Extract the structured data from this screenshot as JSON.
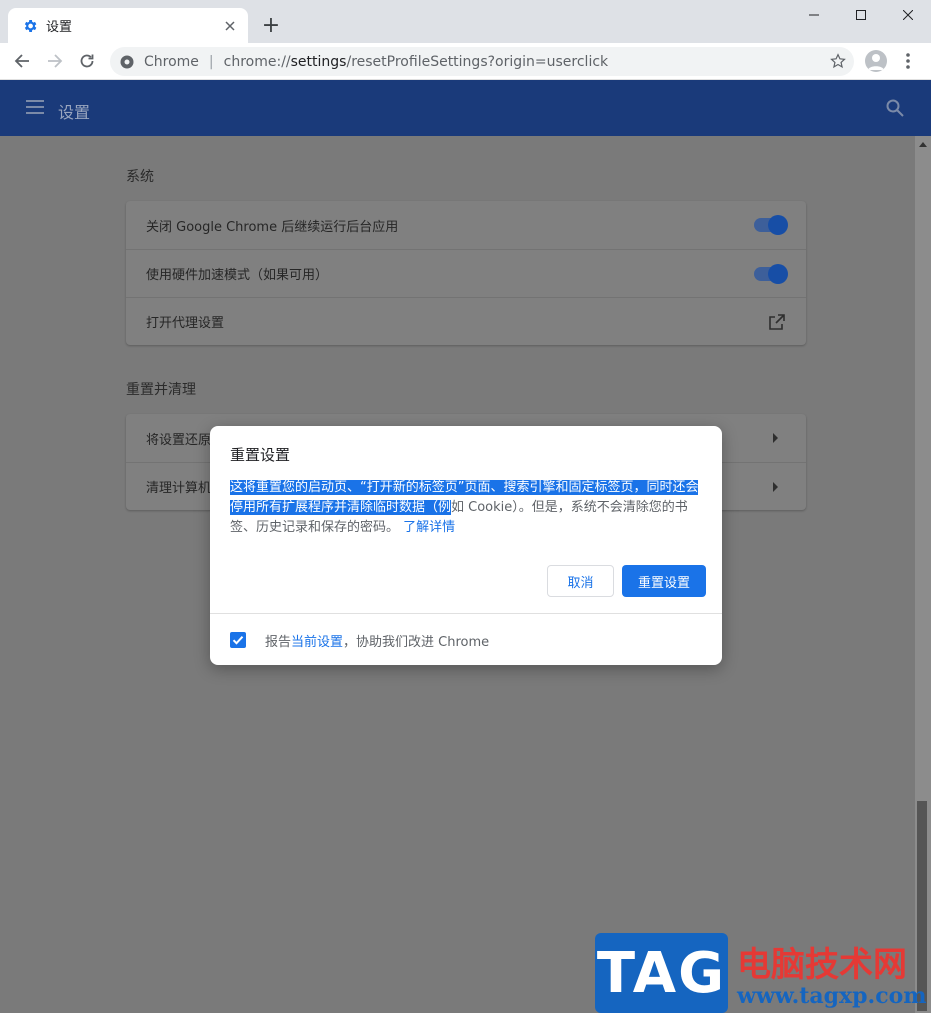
{
  "browser": {
    "tab_title": "设置",
    "new_tab_symbol": "+",
    "omnibox": {
      "scheme_label": "Chrome",
      "url_prefix": "chrome://",
      "url_host": "settings",
      "url_path": "/resetProfileSettings?origin=userclick"
    }
  },
  "settings": {
    "header_title": "设置",
    "system_section": {
      "title": "系统",
      "rows": [
        {
          "label": "关闭 Google Chrome 后继续运行后台应用",
          "enabled": true
        },
        {
          "label": "使用硬件加速模式（如果可用）",
          "enabled": true
        },
        {
          "label": "打开代理设置"
        }
      ]
    },
    "reset_section": {
      "title": "重置并清理",
      "rows": [
        {
          "label": "将设置还原"
        },
        {
          "label": "清理计算机"
        }
      ]
    }
  },
  "dialog": {
    "title": "重置设置",
    "body_highlighted": "这将重置您的启动页、“打开新的标签页”页面、搜索引擎和固定标签页，同时还会停用所有扩展程序并清除临时数据（例",
    "body_rest": "如 Cookie）。但是，系统不会清除您的书签、历史记录和保存的密码。",
    "learn_more": "了解详情",
    "cancel_label": "取消",
    "reset_label": "重置设置",
    "report_prefix": "报告",
    "report_link": "当前设置",
    "report_suffix": "，协助我们改进 Chrome",
    "report_checked": true
  },
  "watermark": {
    "logo_text": "TAG",
    "cn_text": "电脑技术网",
    "site": "www.tagxp.com"
  },
  "colors": {
    "accent": "#1a73e8",
    "header_bg": "#1a3a7a"
  }
}
